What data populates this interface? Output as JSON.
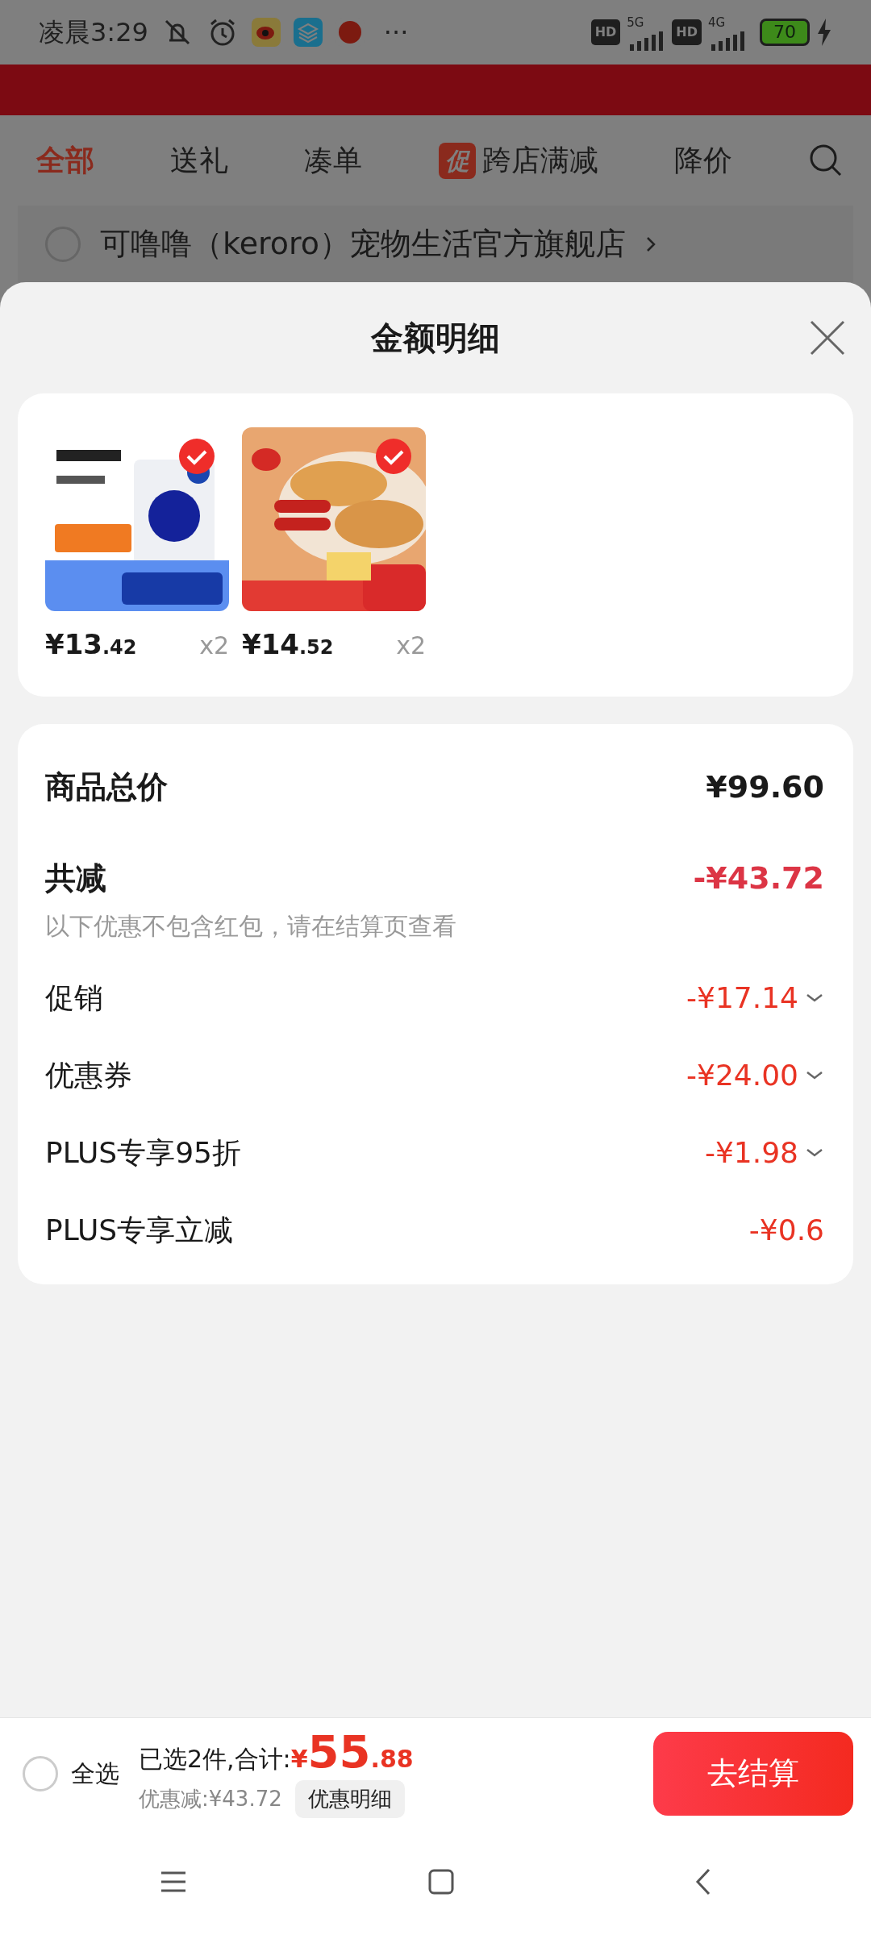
{
  "status_bar": {
    "time": "凌晨3:29",
    "more": "···",
    "network": [
      {
        "hd": "HD",
        "gen": "5G"
      },
      {
        "hd": "HD",
        "gen": "4G"
      }
    ],
    "battery": "70"
  },
  "tabs": [
    {
      "label": "全部",
      "selected": true
    },
    {
      "label": "送礼",
      "selected": false
    },
    {
      "label": "凑单",
      "selected": false
    },
    {
      "label": "跨店满减",
      "badge": "促",
      "selected": false
    },
    {
      "label": "降价",
      "selected": false
    }
  ],
  "store": {
    "name": "可噜噜（keroro）宠物生活官方旗舰店",
    "checked": false
  },
  "sheet": {
    "title": "金额明细",
    "items": [
      {
        "price": "¥13",
        "cents": ".42",
        "qty": "x2",
        "selected": true
      },
      {
        "price": "¥14",
        "cents": ".52",
        "qty": "x2",
        "selected": true
      }
    ],
    "total_label": "商品总价",
    "total": "¥99.60",
    "discount_label": "共减",
    "discount": "-¥43.72",
    "note": "以下优惠不包含红包，请在结算页查看",
    "rows": [
      {
        "label": "促销",
        "amount": "-¥17.14",
        "expandable": true
      },
      {
        "label": "优惠券",
        "amount": "-¥24.00",
        "expandable": true
      },
      {
        "label": "PLUS专享95折",
        "amount": "-¥1.98",
        "expandable": true
      },
      {
        "label": "PLUS专享立减",
        "amount": "-¥0.6",
        "expandable": false
      }
    ]
  },
  "footer": {
    "select_all": {
      "label": "全选",
      "checked": false
    },
    "selected_text": "已选2件,合计:",
    "currency": "¥",
    "total": "55",
    "cents": ".88",
    "saved": "优惠减:¥43.72",
    "detail_button": "优惠明细",
    "checkout_button": "去结算"
  }
}
